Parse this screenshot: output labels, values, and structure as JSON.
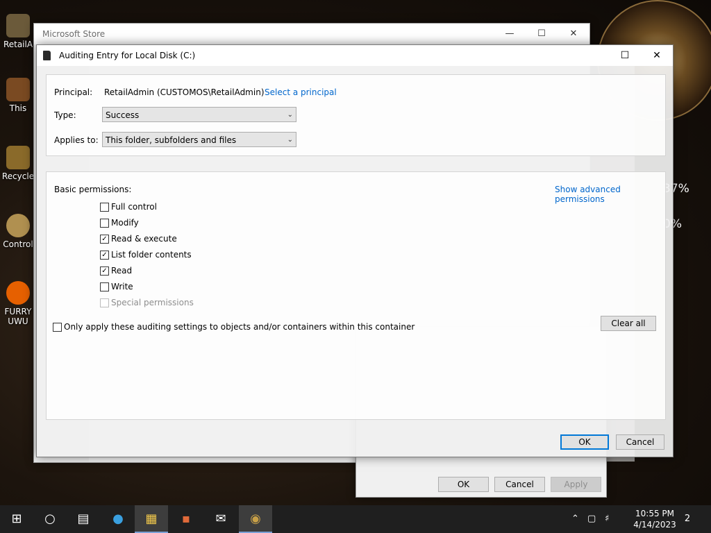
{
  "desktop": {
    "icons": [
      {
        "label": "RetailA"
      },
      {
        "label": "This"
      },
      {
        "label": "Recycle"
      },
      {
        "label": "Control"
      },
      {
        "label": "FURRY\nUWU"
      }
    ],
    "widget_texts": [
      "37%",
      "0%"
    ]
  },
  "store_window": {
    "title": "Microsoft Store"
  },
  "advanced_window": {
    "ok_label": "OK",
    "cancel_label": "Cancel",
    "apply_label": "Apply"
  },
  "dialog": {
    "title": "Auditing Entry for Local Disk (C:)",
    "principal": {
      "label": "Principal:",
      "value": "RetailAdmin (CUSTOMOS\\RetailAdmin)",
      "link": "Select a principal"
    },
    "type": {
      "label": "Type:",
      "value": "Success"
    },
    "applies_to": {
      "label": "Applies to:",
      "value": "This folder, subfolders and files"
    },
    "basic_permissions_label": "Basic permissions:",
    "show_advanced_link": "Show advanced permissions",
    "permissions": [
      {
        "label": "Full control",
        "checked": false,
        "disabled": false
      },
      {
        "label": "Modify",
        "checked": false,
        "disabled": false
      },
      {
        "label": "Read & execute",
        "checked": true,
        "disabled": false
      },
      {
        "label": "List folder contents",
        "checked": true,
        "disabled": false
      },
      {
        "label": "Read",
        "checked": true,
        "disabled": false
      },
      {
        "label": "Write",
        "checked": false,
        "disabled": false
      },
      {
        "label": "Special permissions",
        "checked": false,
        "disabled": true
      }
    ],
    "only_apply_label": "Only apply these auditing settings to objects and/or containers within this container",
    "clear_all_label": "Clear all",
    "ok_label": "OK",
    "cancel_label": "Cancel"
  },
  "taskbar": {
    "time": "10:55 PM",
    "date": "4/14/2023",
    "notification_count": "2",
    "icons": [
      "windows-start-icon",
      "search-icon",
      "task-view-icon",
      "edge-icon",
      "file-explorer-icon",
      "store-icon",
      "mail-icon",
      "app-icon"
    ]
  }
}
